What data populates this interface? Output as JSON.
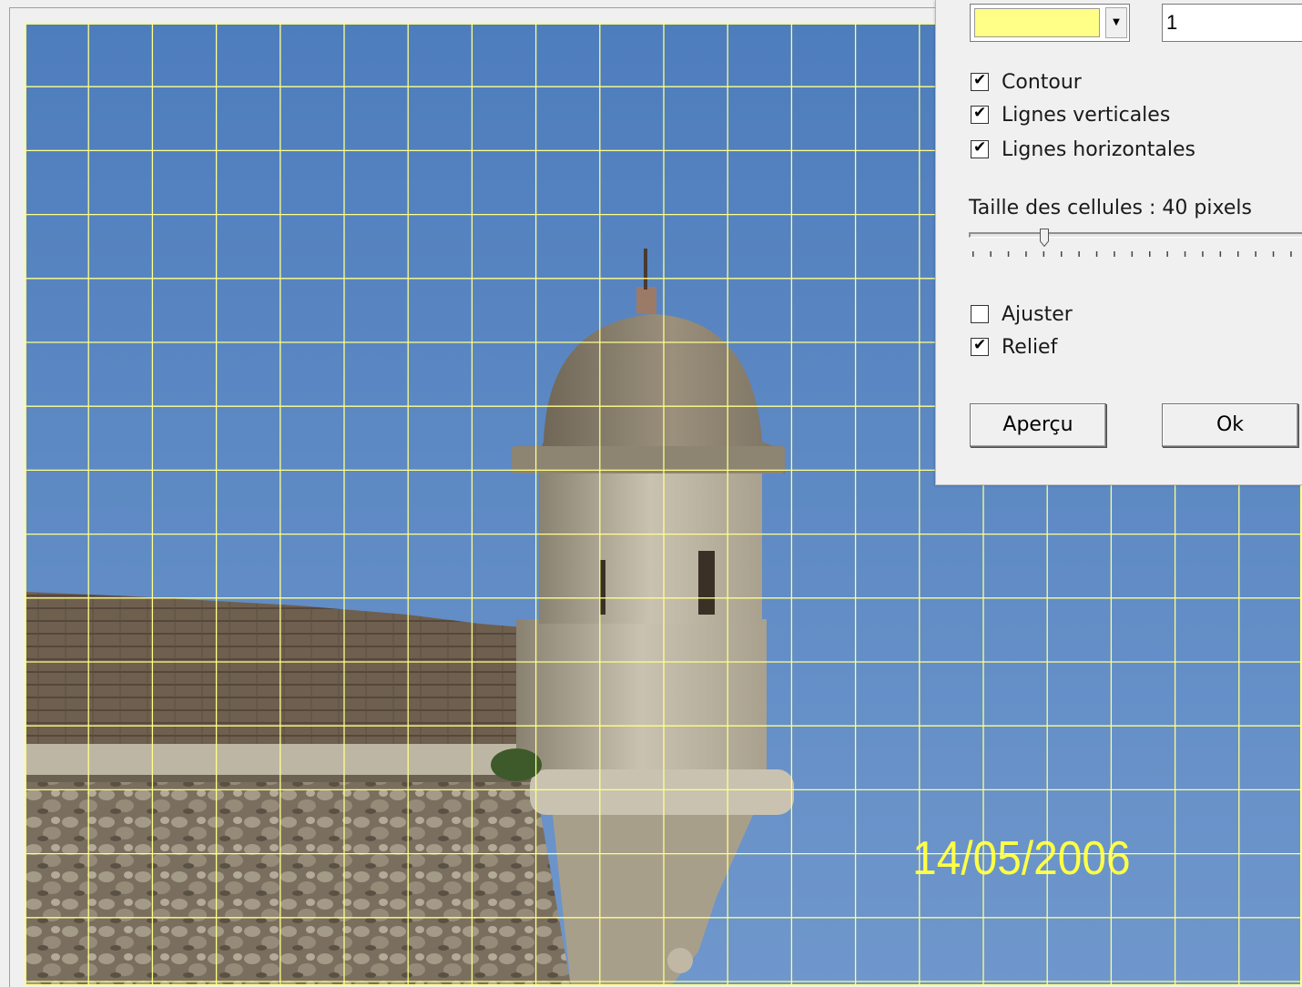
{
  "grid": {
    "color": "#ffff88",
    "cell_size_px": 40
  },
  "photo": {
    "date_stamp": "14/05/2006",
    "date_stamp_color": "#ffff44",
    "sky_color": "#5b86c2"
  },
  "dialog": {
    "line_color": "#ffff88",
    "line_width_value": "1",
    "checkboxes": [
      {
        "label": "Contour",
        "checked": true
      },
      {
        "label": "Lignes verticales",
        "checked": true
      },
      {
        "label": "Lignes horizontales",
        "checked": true
      }
    ],
    "slider": {
      "label": "Taille des cellules : 40 pixels",
      "value": 40
    },
    "options": [
      {
        "label": "Ajuster",
        "checked": false
      },
      {
        "label": "Relief",
        "checked": true
      }
    ],
    "buttons": {
      "preview": "Aperçu",
      "ok": "Ok"
    }
  },
  "icons": {
    "dropdown": "chevron-down-icon",
    "checkmark": "checkmark-icon"
  }
}
